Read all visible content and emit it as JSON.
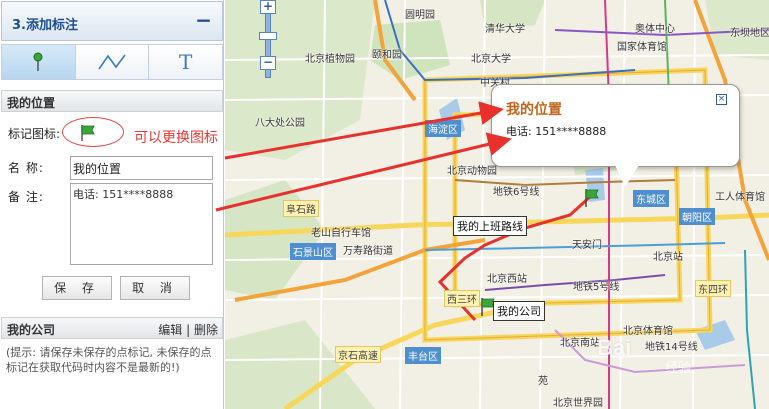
{
  "panel": {
    "title": "3.添加标注",
    "collapse_icon": "minus-icon",
    "tools": [
      {
        "name": "marker-tool",
        "icon": "marker-pin-icon"
      },
      {
        "name": "line-tool",
        "icon": "polyline-icon"
      },
      {
        "name": "text-tool",
        "icon": "text-t-icon",
        "glyph": "T"
      }
    ],
    "section_title": "我的位置",
    "icon_label": "标记图标:",
    "change_icon_hint": "可以更换图标",
    "name_label": "名 称:",
    "name_value": "我的位置",
    "note_label": "备 注:",
    "note_value": "电话: 151****8888",
    "save_label": "保 存",
    "cancel_label": "取 消",
    "company_title": "我的公司",
    "company_edit": "编辑",
    "company_divider": "|",
    "company_delete": "删除",
    "hint": "(提示: 请保存未保存的点标记, 未保存的点标记在获取代码时内容不是最新的!)"
  },
  "map": {
    "labels": {
      "yuanmingyuan": "圆明园",
      "tsinghua": "清华大学",
      "botanical": "北京植物园",
      "yiheyuan": "颐和园",
      "pku": "北京大学",
      "zhongguancun": "中关村",
      "aoti": "奥体中心",
      "guojia_tiyuguan": "国家体育馆",
      "dongba": "东坝地区",
      "badachu": "八大处公园",
      "haidian": "海淀区",
      "beijing_zoo": "北京动物园",
      "metro6": "地铁6号线",
      "dongcheng": "东城区",
      "gongren_tiyuguan": "工人体育馆",
      "chaoyang": "朝阳区",
      "fushilu": "阜石路",
      "laoshan": "老山自行车馆",
      "shijingshan": "石景山区",
      "wanshou": "万寿路街道",
      "xisanhuan": "西三环",
      "tiananmen": "天安门",
      "beijingzhan": "北京站",
      "beijingxi": "北京西站",
      "metro5": "地铁5号线",
      "jingshi": "京石高速",
      "fengtai": "丰台区",
      "beijingnan": "北京南站",
      "metro14": "地铁14号线",
      "beijing_tiyuguan": "北京体育馆",
      "shijieyuan": "北京世界园",
      "dongsihuan": "东四环",
      "yuan": "苑"
    },
    "route_tag": "我的上班路线",
    "company_tag": "我的公司",
    "zoom_plus": "+",
    "zoom_minus": "−",
    "info_window": {
      "title": "我的位置",
      "phone": "电话: 151****8888",
      "close": "×"
    },
    "watermark": "Bai",
    "watermark_sub": "经验"
  },
  "colors": {
    "accent": "#1d4f91",
    "hint_red": "#e53935",
    "route_red": "#e8312c",
    "info_title": "#c0651b",
    "flag_green": "#3aa637"
  }
}
